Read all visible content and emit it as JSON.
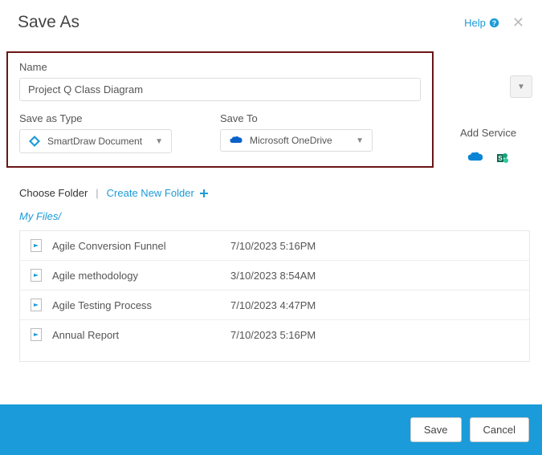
{
  "dialog": {
    "title": "Save As",
    "help": "Help"
  },
  "name": {
    "label": "Name",
    "value": "Project Q Class Diagram"
  },
  "save_type": {
    "label": "Save as Type",
    "selected": "SmartDraw Document"
  },
  "save_to": {
    "label": "Save To",
    "selected": "Microsoft OneDrive"
  },
  "add_service": {
    "label": "Add Service"
  },
  "folder": {
    "choose": "Choose Folder",
    "create": "Create New Folder",
    "breadcrumb": "My Files/"
  },
  "files": [
    {
      "name": "Agile Conversion Funnel",
      "date": "7/10/2023 5:16PM"
    },
    {
      "name": "Agile methodology",
      "date": "3/10/2023 8:54AM"
    },
    {
      "name": "Agile Testing Process",
      "date": "7/10/2023 4:47PM"
    },
    {
      "name": "Annual Report",
      "date": "7/10/2023 5:16PM"
    }
  ],
  "buttons": {
    "save": "Save",
    "cancel": "Cancel"
  }
}
